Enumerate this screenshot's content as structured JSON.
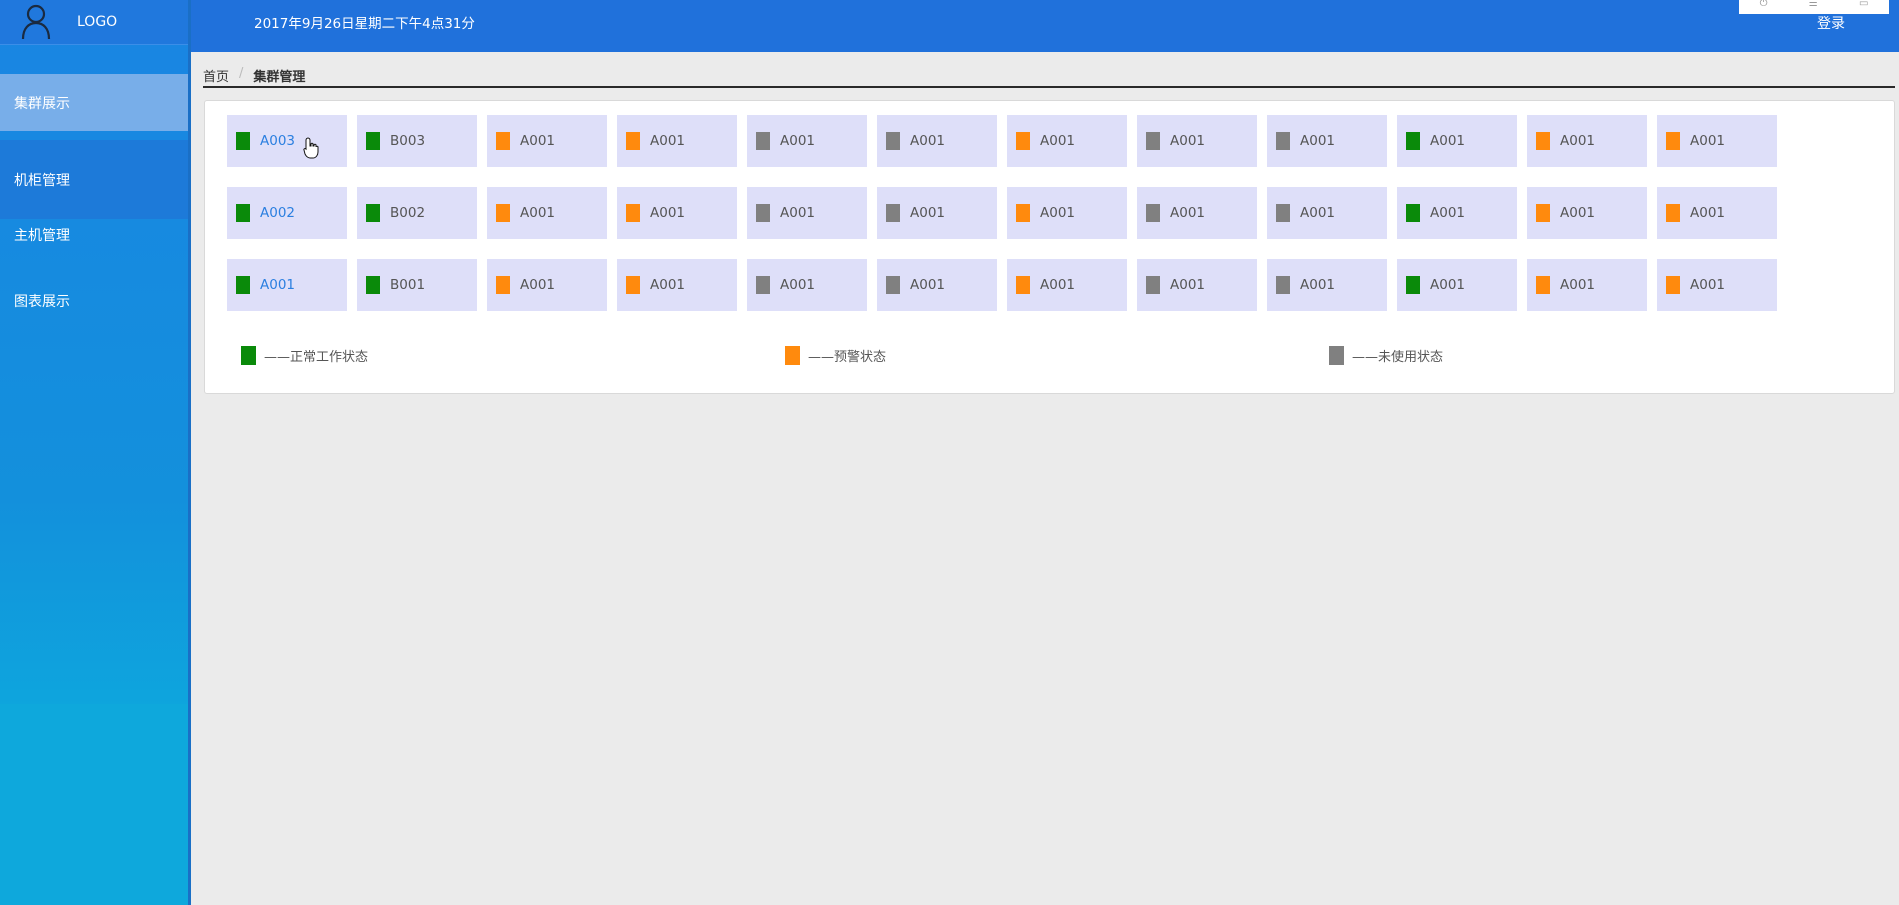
{
  "sidebar": {
    "logo": "LOGO",
    "items": [
      {
        "label": "集群展示",
        "active": true
      },
      {
        "label": "机柜管理",
        "active": false
      },
      {
        "label": "主机管理",
        "active": false
      },
      {
        "label": "图表展示",
        "active": false
      }
    ]
  },
  "header": {
    "datetime": "2017年9月26日星期二下午4点31分",
    "login": "登录"
  },
  "breadcrumb": {
    "home": "首页",
    "separator": "/",
    "current": "集群管理"
  },
  "status_colors": {
    "green": "#0a8a0a",
    "orange": "#ff8a0d",
    "gray": "#808080"
  },
  "grid": {
    "rows": [
      [
        {
          "label": "A003",
          "status": "green",
          "highlight": true
        },
        {
          "label": "B003",
          "status": "green"
        },
        {
          "label": "A001",
          "status": "orange"
        },
        {
          "label": "A001",
          "status": "orange"
        },
        {
          "label": "A001",
          "status": "gray"
        },
        {
          "label": "A001",
          "status": "gray"
        },
        {
          "label": "A001",
          "status": "orange"
        },
        {
          "label": "A001",
          "status": "gray"
        },
        {
          "label": "A001",
          "status": "gray"
        },
        {
          "label": "A001",
          "status": "green"
        },
        {
          "label": "A001",
          "status": "orange"
        },
        {
          "label": "A001",
          "status": "orange"
        }
      ],
      [
        {
          "label": "A002",
          "status": "green",
          "highlight": true
        },
        {
          "label": "B002",
          "status": "green"
        },
        {
          "label": "A001",
          "status": "orange"
        },
        {
          "label": "A001",
          "status": "orange"
        },
        {
          "label": "A001",
          "status": "gray"
        },
        {
          "label": "A001",
          "status": "gray"
        },
        {
          "label": "A001",
          "status": "orange"
        },
        {
          "label": "A001",
          "status": "gray"
        },
        {
          "label": "A001",
          "status": "gray"
        },
        {
          "label": "A001",
          "status": "green"
        },
        {
          "label": "A001",
          "status": "orange"
        },
        {
          "label": "A001",
          "status": "orange"
        }
      ],
      [
        {
          "label": "A001",
          "status": "green",
          "highlight": true
        },
        {
          "label": "B001",
          "status": "green"
        },
        {
          "label": "A001",
          "status": "orange"
        },
        {
          "label": "A001",
          "status": "orange"
        },
        {
          "label": "A001",
          "status": "gray"
        },
        {
          "label": "A001",
          "status": "gray"
        },
        {
          "label": "A001",
          "status": "orange"
        },
        {
          "label": "A001",
          "status": "gray"
        },
        {
          "label": "A001",
          "status": "gray"
        },
        {
          "label": "A001",
          "status": "green"
        },
        {
          "label": "A001",
          "status": "orange"
        },
        {
          "label": "A001",
          "status": "orange"
        }
      ]
    ]
  },
  "legend": [
    {
      "label": "——正常工作状态",
      "status": "green"
    },
    {
      "label": "——预警状态",
      "status": "orange"
    },
    {
      "label": "——未使用状态",
      "status": "gray"
    }
  ]
}
